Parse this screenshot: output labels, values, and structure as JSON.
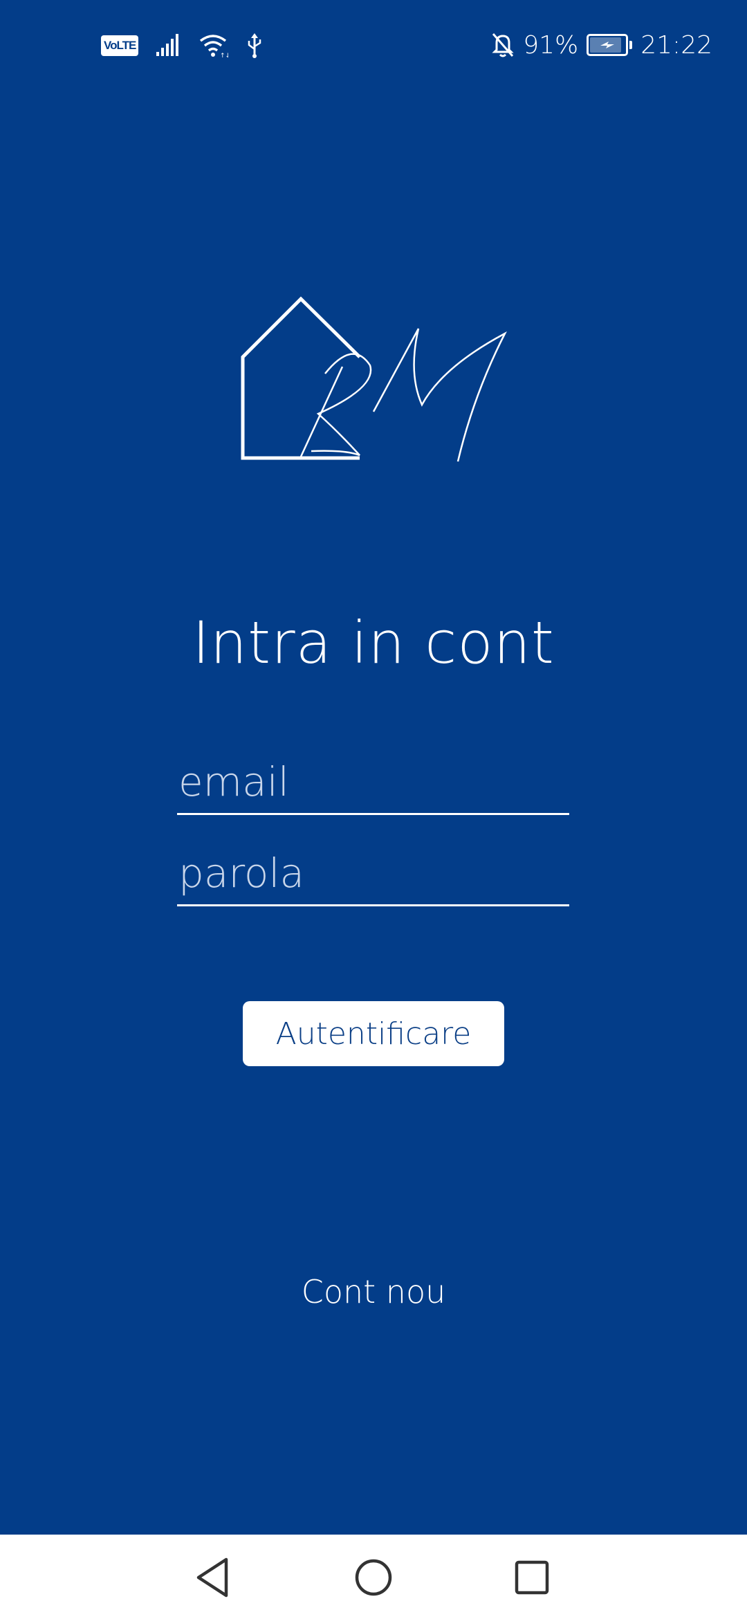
{
  "status_bar": {
    "network_badge": "VoLTE",
    "signal_icon": "signal-bars-icon",
    "wifi_icon": "wifi-icon",
    "usb_icon": "usb-icon",
    "silent_icon": "bell-off-icon",
    "battery_percent": "91%",
    "battery_level": 0.91,
    "time": "21:22"
  },
  "logo": {
    "initials": "RM",
    "icon": "house-logo-icon"
  },
  "login": {
    "title": "Intra in cont",
    "email_placeholder": "email",
    "email_value": "",
    "password_placeholder": "parola",
    "password_value": "",
    "submit_label": "Autentificare",
    "new_account_label": "Cont nou"
  },
  "nav_bar": {
    "back_icon": "triangle-back-icon",
    "home_icon": "circle-home-icon",
    "recent_icon": "square-recents-icon"
  },
  "colors": {
    "background": "#033d89",
    "button_text": "#0b3f86",
    "foreground": "#ffffff"
  }
}
